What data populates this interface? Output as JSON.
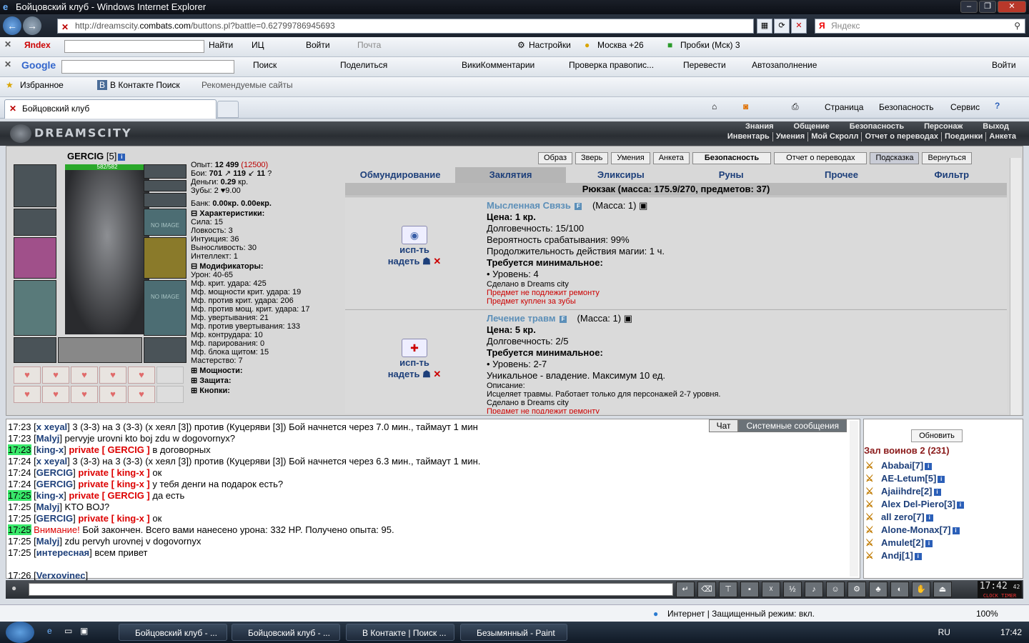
{
  "window": {
    "title": "Бойцовский клуб - Windows Internet Explorer"
  },
  "address": {
    "url_pre": "http://dreamscity.",
    "url_host": "combats.com",
    "url_post": "/buttons.pl?battle=0.62799786945693",
    "search_placeholder": "Яндекс"
  },
  "toolbar1": {
    "brand": "Яndex",
    "find": "Найти",
    "ic": "ИЦ",
    "login": "Войти",
    "mail": "Почта",
    "settings": "Настройки",
    "weather": "Москва +26",
    "traffic": "Пробки (Мск) 3"
  },
  "toolbar2": {
    "brand": "Google",
    "search": "Поиск",
    "share": "Поделиться",
    "wiki": "ВикиКомментарии",
    "spell": "Проверка правопис...",
    "translate": "Перевести",
    "autofill": "Автозаполнение",
    "login": "Войти"
  },
  "toolbar3": {
    "favorites": "Избранное",
    "vk": "В Контакте  Поиск",
    "recommended": "Рекомендуемые сайты"
  },
  "tab": {
    "title": "Бойцовский клуб",
    "page": "Страница",
    "security": "Безопасность",
    "service": "Сервис"
  },
  "game_menu": {
    "row1": [
      "Знания",
      "Общение",
      "Безопасность",
      "Персонаж",
      "Выход"
    ],
    "row2": [
      "Инвентарь",
      "Умения",
      "Мой Скролл",
      "Отчет о переводах",
      "Поединки",
      "Анкета"
    ],
    "logo": "DREAMSCITY"
  },
  "character": {
    "name": "GERCIG",
    "level": "[5]",
    "hp": "582/582"
  },
  "stats": {
    "exp_label": "Опыт: ",
    "exp": "12 499",
    "exp_next": "(12500)",
    "battles_label": "Бои: ",
    "battles": "701",
    "wins": "119",
    "losses": "11",
    "money_label": "Деньги: ",
    "money": "0.29",
    "money_unit": "кр.",
    "teeth_label": "Зубы: ",
    "teeth": "2 ♥9.00",
    "bank_label": "Банк: ",
    "bank": "0.00кр. 0.00екр.",
    "chars_head": "Характеристики:",
    "chars": [
      "Сила: 15",
      "Ловкость: 3",
      "Интуиция: 36",
      "Выносливость: 30",
      "Интеллект: 1"
    ],
    "mods_head": "Модификаторы:",
    "mods": [
      "Урон: 40-65",
      "Мф. крит. удара: 425",
      "Мф. мощности крит. удара: 19",
      "Мф. против крит. удара: 206",
      "Мф. против мощ. крит. удара: 17",
      "Мф. увертывания: 21",
      "Мф. против увертывания: 133",
      "Мф. контрудара: 10",
      "Мф. парирования: 0",
      "Мф. блока щитом: 15",
      "Мастерство: 7"
    ],
    "power_head": "Мощности:",
    "defense_head": "Защита:",
    "buttons_head": "Кнопки:"
  },
  "top_buttons": [
    "Образ",
    "Зверь",
    "Умения",
    "Анкета",
    "Безопасность",
    "Отчет о переводах",
    "Подсказка",
    "Вернуться"
  ],
  "inv_tabs": [
    "Обмундирование",
    "Заклятия",
    "Эликсиры",
    "Руны",
    "Прочее",
    "Фильтр"
  ],
  "backpack": "Рюкзак (масса: 175.9/270, предметов: 37)",
  "items": [
    {
      "name": "Мысленная Связь",
      "mass": "(Масса: 1)",
      "use": "исп-ть",
      "wear": "надеть",
      "lines": [
        "Цена: 1 кр.",
        "Долговечность: 15/100",
        "Вероятность срабатывания: 99%",
        "Продолжительность действия магии: 1 ч.",
        "Требуется минимальное:",
        "• Уровень: 4"
      ],
      "made": "Сделано в Dreams city",
      "red1": "Предмет не подлежит ремонту",
      "red2": "Предмет куплен за зубы"
    },
    {
      "name": "Лечение травм",
      "mass": "(Масса: 1)",
      "use": "исп-ть",
      "wear": "надеть",
      "lines": [
        "Цена: 5 кр.",
        "Долговечность: 2/5",
        "Требуется минимальное:",
        "• Уровень: 2-7",
        "Уникальное - владение. Максимум 10 ед."
      ],
      "desc_label": "Описание:",
      "desc": "Исцеляет травмы. Работает только для персонажей 2-7 уровня.",
      "made": "Сделано в Dreams city",
      "red1": "Предмет не подлежит ремонту"
    }
  ],
  "chat_tabs": [
    "Чат",
    "Системные сообщения"
  ],
  "chat": [
    {
      "t": "17:23",
      "n": "x xeyal",
      "txt": " 3 (3-3) на 3 (3-3) (x хеял [3]) против (Куцеряви [3]) Бой начнется через 7.0 мин., таймаут 1 мин"
    },
    {
      "t": "17:23",
      "n": "Malyj",
      "txt": " pervyje urovni kto boj zdu w dogovornyx?"
    },
    {
      "t": "17:23",
      "n": "king-x",
      "p": "private [ GERCIG ]",
      "txt": " в договорных",
      "hl": true
    },
    {
      "t": "17:24",
      "n": "x xeyal",
      "txt": " 3 (3-3) на 3 (3-3) (x хеял [3]) против (Куцеряви [3]) Бой начнется через 6.3 мин., таймаут 1 мин."
    },
    {
      "t": "17:24",
      "n": "GERCIG",
      "p": "private [ king-x ]",
      "txt": " ок"
    },
    {
      "t": "17:24",
      "n": "GERCIG",
      "p": "private [ king-x ]",
      "txt": " у тебя денги на подарок есть?"
    },
    {
      "t": "17:25",
      "n": "king-x",
      "p": "private [ GERCIG ]",
      "txt": " да есть",
      "hl": true
    },
    {
      "t": "17:25",
      "n": "Malyj",
      "txt": " KTO BOJ?"
    },
    {
      "t": "17:25",
      "n": "GERCIG",
      "p": "private [ king-x ]",
      "txt": " ок"
    },
    {
      "t": "17:25",
      "sys": "Внимание!",
      "txt": " Бой закончен. Всего вами нанесено урона: 332 HP. Получено опыта: 95.",
      "hl": true
    },
    {
      "t": "17:25",
      "n": "Malyj",
      "txt": " zdu pervyh urovnej v dogovornyx"
    },
    {
      "t": "17:25",
      "n": "интересная",
      "txt": " всем привет"
    },
    {
      "t": "",
      "n": "",
      "txt": ""
    },
    {
      "t": "17:26",
      "n": "Verxovinec",
      "txt": ""
    }
  ],
  "users": {
    "refresh": "Обновить",
    "room": "Зал воинов 2 (231)",
    "list": [
      "Ababai[7]",
      "AE-Letum[5]",
      "Ajaiihdre[2]",
      "Alex Del-Piero[3]",
      "all zero[7]",
      "Alone-Monax[7]",
      "Amulet[2]",
      "Andj[1]"
    ]
  },
  "clock": {
    "time": "17:42",
    "sec": "42",
    "label": "CLOCK TIMER"
  },
  "status": {
    "zone": "Интернет | Защищенный режим: вкл.",
    "zoom": "100%"
  },
  "taskbar": {
    "items": [
      "Бойцовский клуб - ...",
      "Бойцовский клуб - ...",
      "В Контакте | Поиск ...",
      "Безымянный - Paint"
    ],
    "lang": "RU",
    "time": "17:42"
  }
}
